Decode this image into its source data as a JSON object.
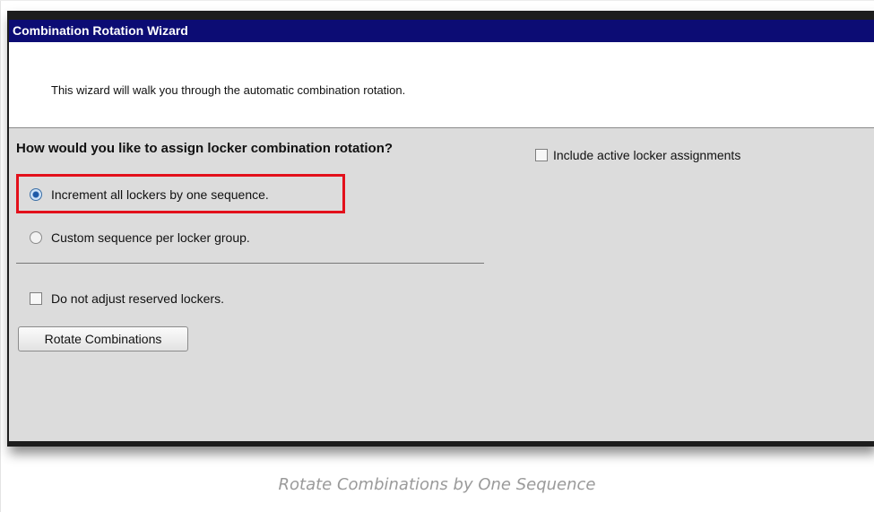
{
  "wizard": {
    "title": "Combination Rotation Wizard",
    "intro": "This wizard will walk you through the automatic combination rotation.",
    "question": "How would you like to assign locker combination rotation?",
    "options": [
      {
        "label": "Increment all lockers by one sequence.",
        "checked": true
      },
      {
        "label": "Custom sequence per locker group.",
        "checked": false
      }
    ],
    "include_active": {
      "label": "Include active locker assignments",
      "checked": false
    },
    "do_not_adjust": {
      "label": "Do not adjust reserved lockers.",
      "checked": false
    },
    "rotate_button": "Rotate Combinations"
  },
  "caption": "Rotate Combinations by One Sequence",
  "colors": {
    "titlebar": "#0c0c74",
    "panel": "#dcdcdc",
    "highlight": "#e3101b"
  }
}
